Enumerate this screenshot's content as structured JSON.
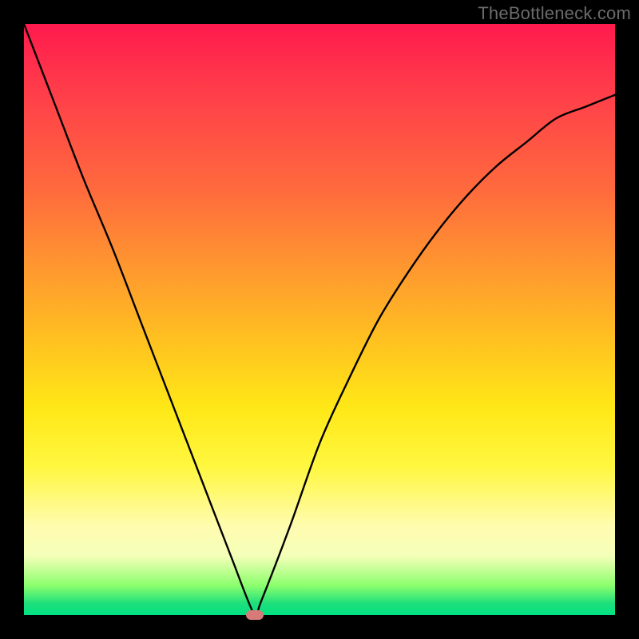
{
  "watermark": "TheBottleneck.com",
  "colors": {
    "frame": "#000000",
    "gradient_top": "#ff1a4d",
    "gradient_bottom": "#00e183",
    "curve": "#000000",
    "marker": "#d77b78",
    "watermark_text": "#6b6b6b"
  },
  "chart_data": {
    "type": "line",
    "title": "",
    "xlabel": "",
    "ylabel": "",
    "xlim": [
      0,
      100
    ],
    "ylim": [
      0,
      100
    ],
    "grid": false,
    "legend": false,
    "comment": "y = bottleneck severity (0 at optimum, 100 at worst). Background gradient: red (top, high y) → green (bottom, low y). Minimum at x≈39.",
    "x": [
      0,
      5,
      10,
      15,
      20,
      25,
      30,
      35,
      39,
      40,
      45,
      50,
      55,
      60,
      65,
      70,
      75,
      80,
      85,
      90,
      95,
      100
    ],
    "values": [
      100,
      87,
      74,
      62,
      49,
      36,
      23,
      10,
      0,
      2,
      15,
      29,
      40,
      50,
      58,
      65,
      71,
      76,
      80,
      84,
      86,
      88
    ],
    "marker": {
      "x": 39,
      "y": 0
    }
  }
}
